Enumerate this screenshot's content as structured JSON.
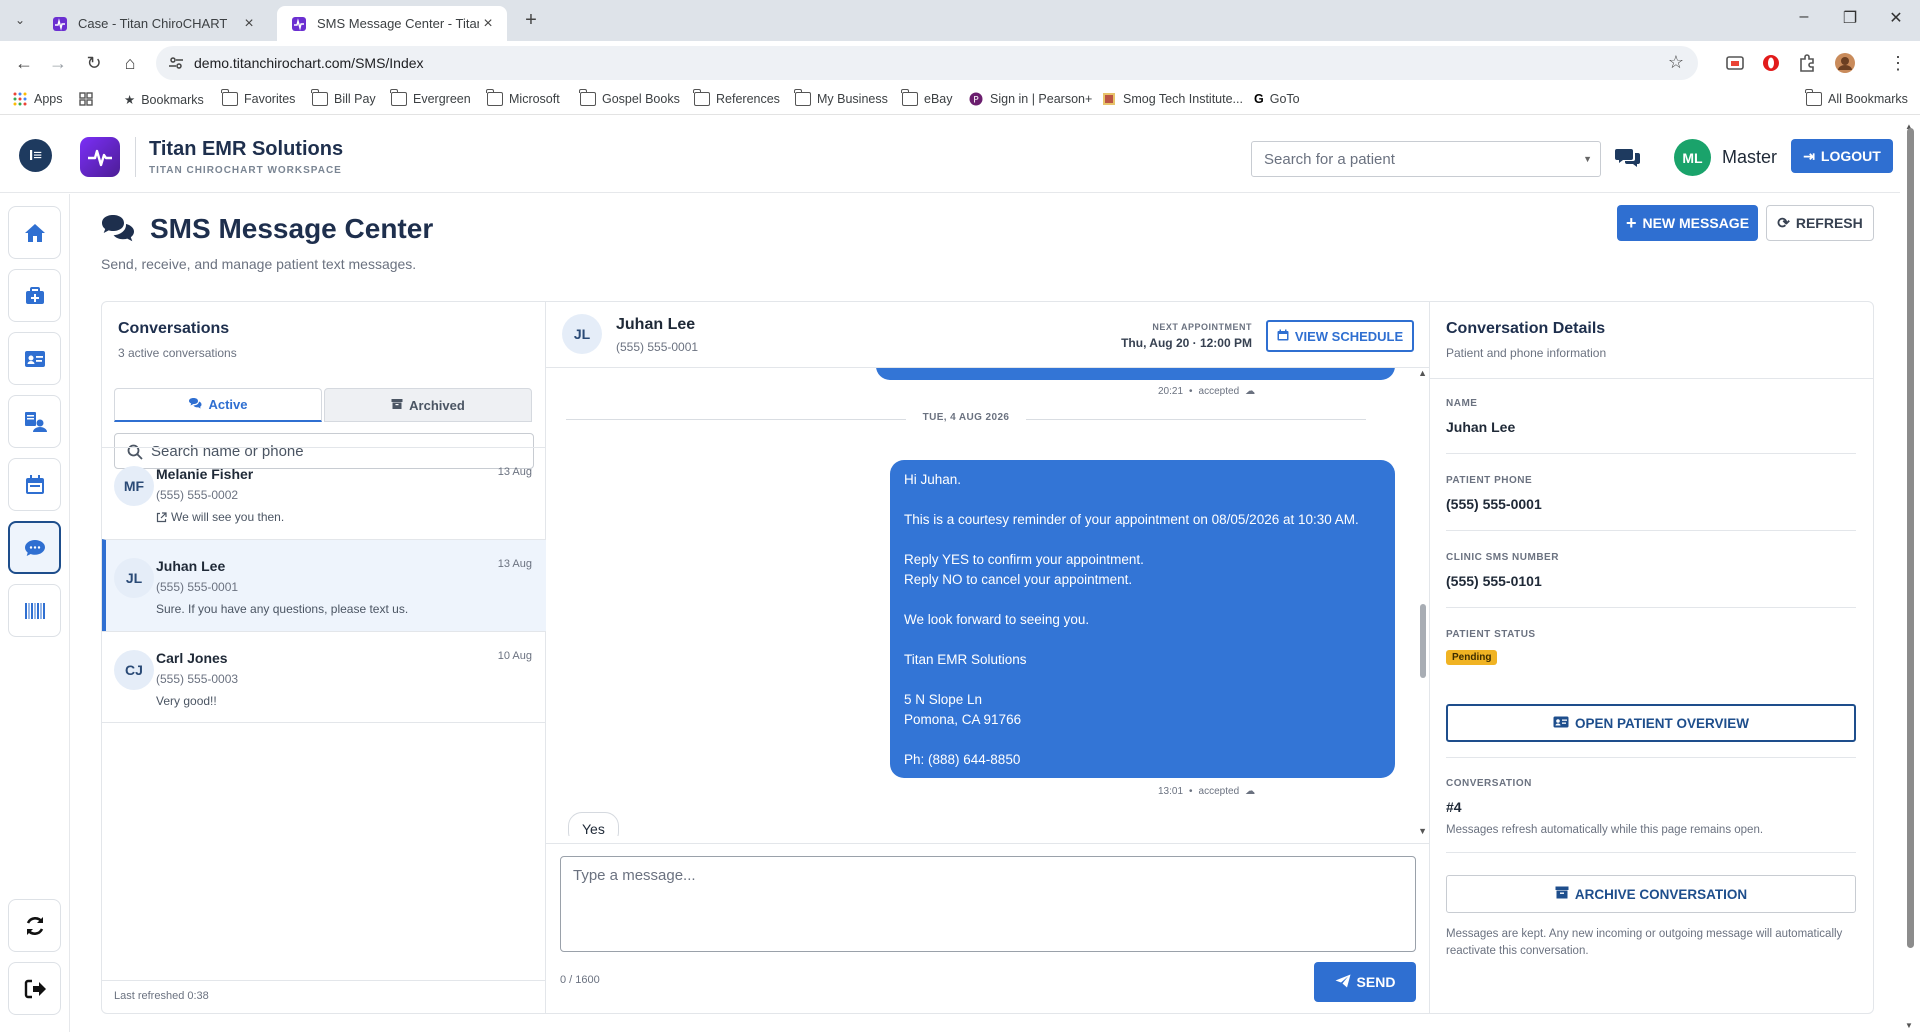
{
  "browser": {
    "tabs": [
      {
        "title": "Case - Titan ChiroCHART",
        "active": false
      },
      {
        "title": "SMS Message Center - Titan Ch",
        "active": true
      }
    ],
    "url": "demo.titanchirochart.com/SMS/Index",
    "bookmarks": [
      "Apps",
      "Bookmarks",
      "Favorites",
      "Bill Pay",
      "Evergreen",
      "Microsoft",
      "Gospel Books",
      "References",
      "My Business",
      "eBay",
      "Sign in | Pearson+",
      "Smog Tech Institute...",
      "GoTo"
    ],
    "all_bookmarks": "All Bookmarks"
  },
  "header": {
    "brand_name": "Titan EMR Solutions",
    "brand_sub": "TITAN CHIROCHART WORKSPACE",
    "search_placeholder": "Search for a patient",
    "avatar_initials": "ML",
    "user_name": "Master",
    "logout_label": "LOGOUT"
  },
  "rail": {
    "items": [
      "home-icon",
      "medical-kit-icon",
      "id-card-icon",
      "user-list-icon",
      "calendar-icon",
      "chat-icon",
      "barcode-icon"
    ],
    "bottom": [
      "sync-icon",
      "sign-out-icon"
    ],
    "active": "chat-icon"
  },
  "page": {
    "title": "SMS Message Center",
    "subtitle": "Send, receive, and manage patient text messages.",
    "new_message_label": "NEW MESSAGE",
    "refresh_label": "REFRESH"
  },
  "conversations": {
    "title": "Conversations",
    "count_text": "3 active conversations",
    "tab_active": "Active",
    "tab_archived": "Archived",
    "search_placeholder": "Search name or phone",
    "items": [
      {
        "initials": "MF",
        "name": "Melanie Fisher",
        "phone": "(555) 555-0002",
        "preview": "We will see you then.",
        "date": "13 Aug",
        "selected": false
      },
      {
        "initials": "JL",
        "name": "Juhan Lee",
        "phone": "(555) 555-0001",
        "preview": "Sure. If you have any questions, please text us.",
        "date": "13 Aug",
        "selected": true
      },
      {
        "initials": "CJ",
        "name": "Carl Jones",
        "phone": "(555) 555-0003",
        "preview": "Very good!!",
        "date": "10 Aug",
        "selected": false
      }
    ],
    "last_refreshed": "Last refreshed 0:38"
  },
  "thread": {
    "initials": "JL",
    "name": "Juhan Lee",
    "phone": "(555) 555-0001",
    "next_appt_label": "NEXT APPOINTMENT",
    "next_appt_value": "Thu, Aug 20 · 12:00 PM",
    "view_schedule_label": "VIEW SCHEDULE",
    "prev_meta_time": "20:21",
    "prev_meta_status": "accepted",
    "day_separator": "TUE, 4 AUG 2026",
    "outgoing": {
      "greeting": "Hi Juhan.",
      "line1": "This is a courtesy reminder of your appointment on 08/05/2026 at 10:30 AM.",
      "line2": "Reply YES to confirm your appointment.",
      "line3": "Reply NO to cancel your appointment.",
      "line4": "We look forward to seeing you.",
      "line5": "Titan EMR Solutions",
      "line6": "5 N Slope Ln",
      "line7": "Pomona, CA 91766",
      "line8": "Ph: (888) 644-8850"
    },
    "outgoing_meta_time": "13:01",
    "outgoing_meta_status": "accepted",
    "incoming_text": "Yes",
    "compose_placeholder": "Type a message...",
    "char_count": "0 / 1600",
    "send_label": "SEND"
  },
  "details": {
    "title": "Conversation Details",
    "subtitle": "Patient and phone information",
    "name_label": "NAME",
    "name_value": "Juhan Lee",
    "phone_label": "PATIENT PHONE",
    "phone_value": "(555) 555-0001",
    "clinic_label": "CLINIC SMS NUMBER",
    "clinic_value": "(555) 555-0101",
    "status_label": "PATIENT STATUS",
    "status_value": "Pending",
    "open_overview_label": "OPEN PATIENT OVERVIEW",
    "conversation_label": "CONVERSATION",
    "conversation_value": "#4",
    "refresh_note": "Messages refresh automatically while this page remains open.",
    "archive_label": "ARCHIVE CONVERSATION",
    "archive_note": "Messages are kept. Any new incoming or outgoing message will automatically reactivate this conversation."
  },
  "colors": {
    "primary": "#2f6fd1",
    "navy": "#1e2f4d",
    "pending": "#f0b323",
    "bubble": "#3375d6"
  }
}
